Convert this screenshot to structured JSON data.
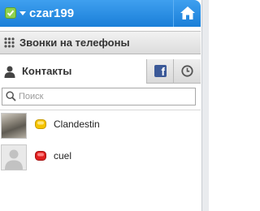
{
  "header": {
    "username": "czar199",
    "status_icon": "online-check-icon",
    "home_icon": "home-icon"
  },
  "calls_bar": {
    "label": "Звонки на телефоны",
    "icon": "dialpad-icon"
  },
  "tabs": {
    "contacts_label": "Контакты",
    "facebook_icon": "facebook-icon",
    "history_icon": "clock-icon"
  },
  "search": {
    "placeholder": "Поиск",
    "value": ""
  },
  "contacts": [
    {
      "name": "Clandestin",
      "status": "away",
      "status_color": "#f5c400",
      "avatar": "photo"
    },
    {
      "name": "cuel",
      "status": "do-not-disturb",
      "status_color": "#e02020",
      "avatar": "default"
    }
  ],
  "colors": {
    "header_blue": "#1a7fd8",
    "online_green": "#8fd14f",
    "facebook_blue": "#3b5998"
  }
}
